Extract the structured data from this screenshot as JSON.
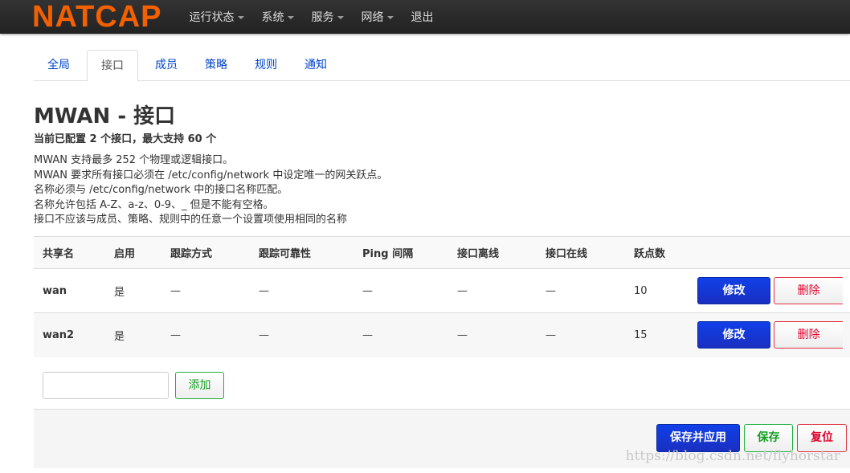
{
  "nav": {
    "logo": "NATCAP",
    "menus": [
      "运行状态",
      "系统",
      "服务",
      "网络"
    ],
    "logout": "退出"
  },
  "tabs": [
    "全局",
    "接口",
    "成员",
    "策略",
    "规则",
    "通知"
  ],
  "active_tab": "接口",
  "title": "MWAN - 接口",
  "subtitle": "当前已配置 2 个接口，最大支持 60 个",
  "description": [
    "MWAN 支持最多 252 个物理或逻辑接口。",
    "MWAN 要求所有接口必须在 /etc/config/network 中设定唯一的网关跃点。",
    "名称必须与 /etc/config/network 中的接口名称匹配。",
    "名称允许包括 A-Z、a-z、0-9、_ 但是不能有空格。",
    "接口不应该与成员、策略、规则中的任意一个设置项使用相同的名称"
  ],
  "table": {
    "headers": [
      "共享名",
      "启用",
      "跟踪方式",
      "跟踪可靠性",
      "Ping 间隔",
      "接口离线",
      "接口在线",
      "跃点数"
    ],
    "rows": [
      [
        "wan",
        "是",
        "—",
        "—",
        "—",
        "—",
        "—",
        "10"
      ],
      [
        "wan2",
        "是",
        "—",
        "—",
        "—",
        "—",
        "—",
        "15"
      ]
    ],
    "edit_label": "修改",
    "delete_label": "删除"
  },
  "add": {
    "value": "",
    "label": "添加"
  },
  "footer": {
    "save_apply": "保存并应用",
    "save": "保存",
    "reset": "复位"
  },
  "watermark": "https://blog.csdn.net/flyhorstar"
}
